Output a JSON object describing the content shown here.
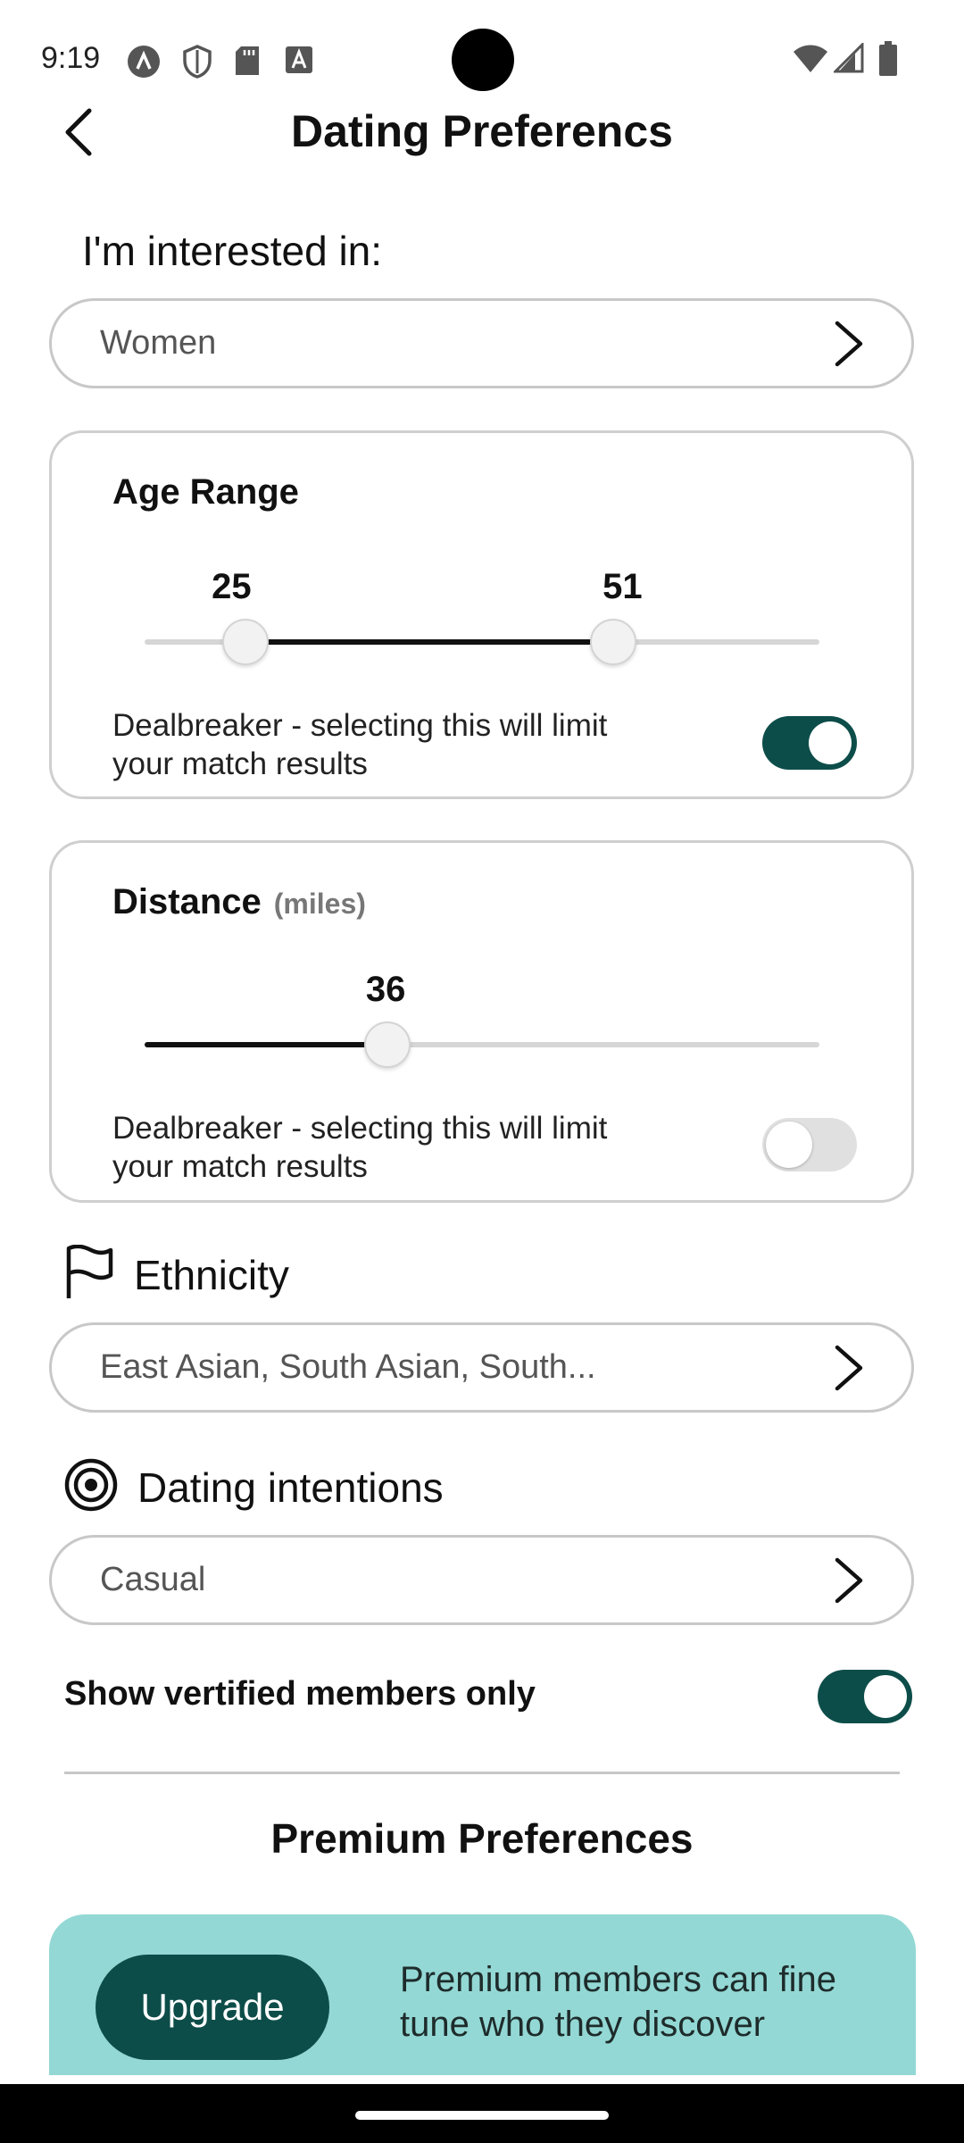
{
  "status_bar": {
    "time": "9:19",
    "left_icons": [
      "notification-a-icon",
      "shield-icon",
      "sd-card-icon",
      "text-a-icon"
    ],
    "right_icons": [
      "wifi-icon",
      "signal-icon",
      "battery-icon"
    ]
  },
  "header": {
    "title": "Dating Preferencs",
    "back_icon": "back-arrow-icon"
  },
  "interested_in": {
    "label": "I'm interested in:",
    "value": "Women"
  },
  "age_range": {
    "title": "Age Range",
    "min_value": "25",
    "max_value": "51",
    "min_fraction": 0.15,
    "max_fraction": 0.695,
    "dealbreaker_text": "Dealbreaker - selecting this will limit your match results",
    "dealbreaker_on": true
  },
  "distance": {
    "title": "Distance",
    "unit": "(miles)",
    "value": "36",
    "fraction": 0.36,
    "dealbreaker_text": "Dealbreaker - selecting this will limit your match results",
    "dealbreaker_on": false
  },
  "ethnicity": {
    "label": "Ethnicity",
    "icon": "flag-icon",
    "value": "East Asian, South Asian, South..."
  },
  "dating_intentions": {
    "label": "Dating intentions",
    "icon": "target-icon",
    "value": "Casual"
  },
  "verified": {
    "label": "Show vertified members only",
    "on": true
  },
  "premium": {
    "title": "Premium Preferences",
    "upgrade_label": "Upgrade",
    "description": "Premium members can fine tune who they discover"
  },
  "colors": {
    "accent": "#0d4d49",
    "premium_bg": "#93d8d4"
  }
}
